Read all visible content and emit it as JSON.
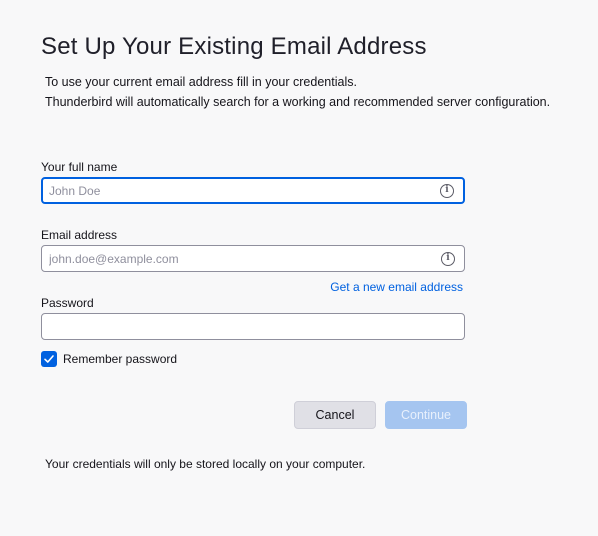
{
  "header": {
    "title": "Set Up Your Existing Email Address",
    "description_line1": "To use your current email address fill in your credentials.",
    "description_line2": "Thunderbird will automatically search for a working and recommended server configuration."
  },
  "form": {
    "full_name": {
      "label": "Your full name",
      "placeholder": "John Doe",
      "value": "",
      "icon": "info-icon"
    },
    "email": {
      "label": "Email address",
      "placeholder": "john.doe@example.com",
      "value": "",
      "icon": "info-icon"
    },
    "new_email_link": "Get a new email address",
    "password": {
      "label": "Password",
      "value": ""
    },
    "remember_password": {
      "label": "Remember password",
      "checked": true
    }
  },
  "buttons": {
    "cancel": "Cancel",
    "continue": "Continue"
  },
  "footer": {
    "note": "Your credentials will only be stored locally on your computer."
  },
  "colors": {
    "accent": "#0061e0",
    "disabled_primary": "#a5c5f0",
    "background": "#f8f8f9"
  }
}
